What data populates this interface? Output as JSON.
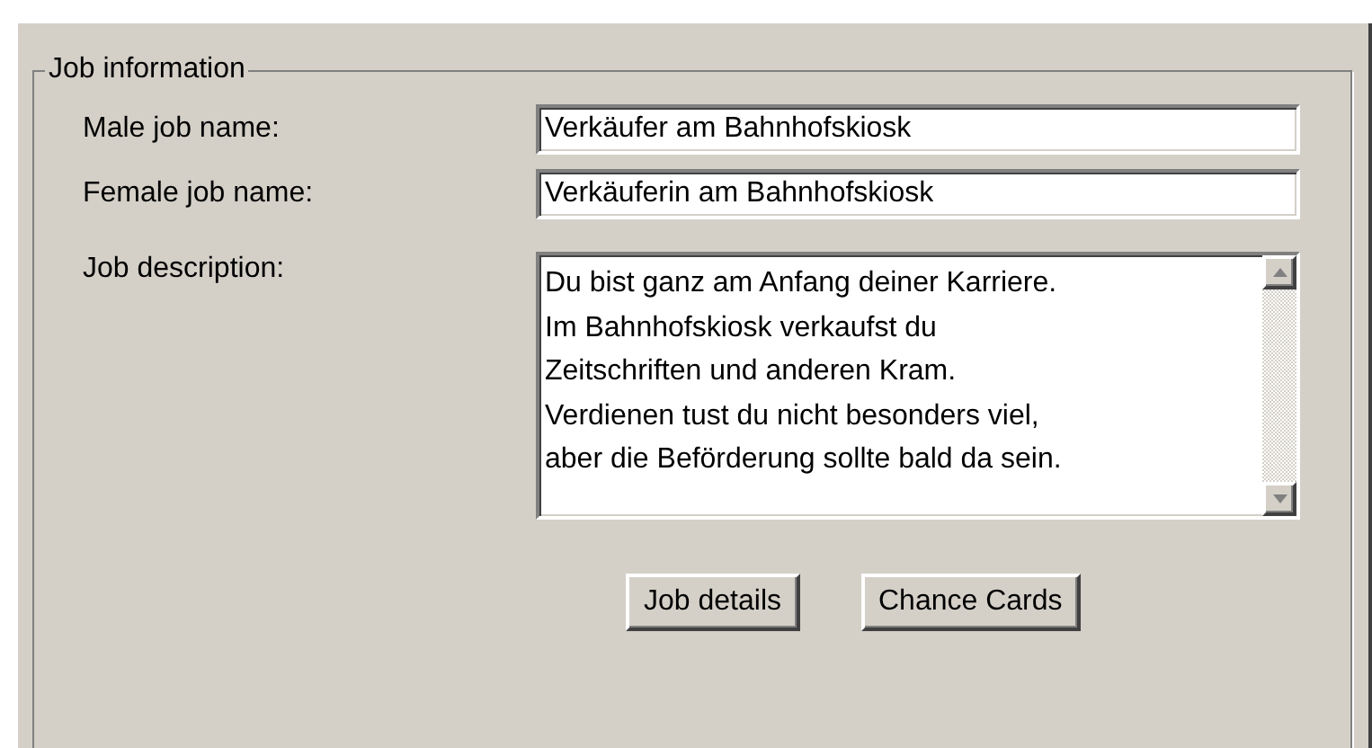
{
  "group": {
    "title": "Job information"
  },
  "fields": [
    {
      "label": "Male job name:",
      "value": "Verkäufer am Bahnhofskiosk"
    },
    {
      "label": "Female job name:",
      "value": "Verkäuferin am Bahnhofskiosk"
    }
  ],
  "description": {
    "label": "Job description:",
    "lines": [
      "Du bist ganz am Anfang deiner Karriere.",
      "Im Bahnhofskiosk verkaufst du",
      "Zeitschriften und anderen Kram.",
      "Verdienen tust du nicht besonders viel,",
      "aber die Beförderung sollte bald da sein."
    ]
  },
  "buttons": [
    "Job details",
    "Chance Cards"
  ]
}
